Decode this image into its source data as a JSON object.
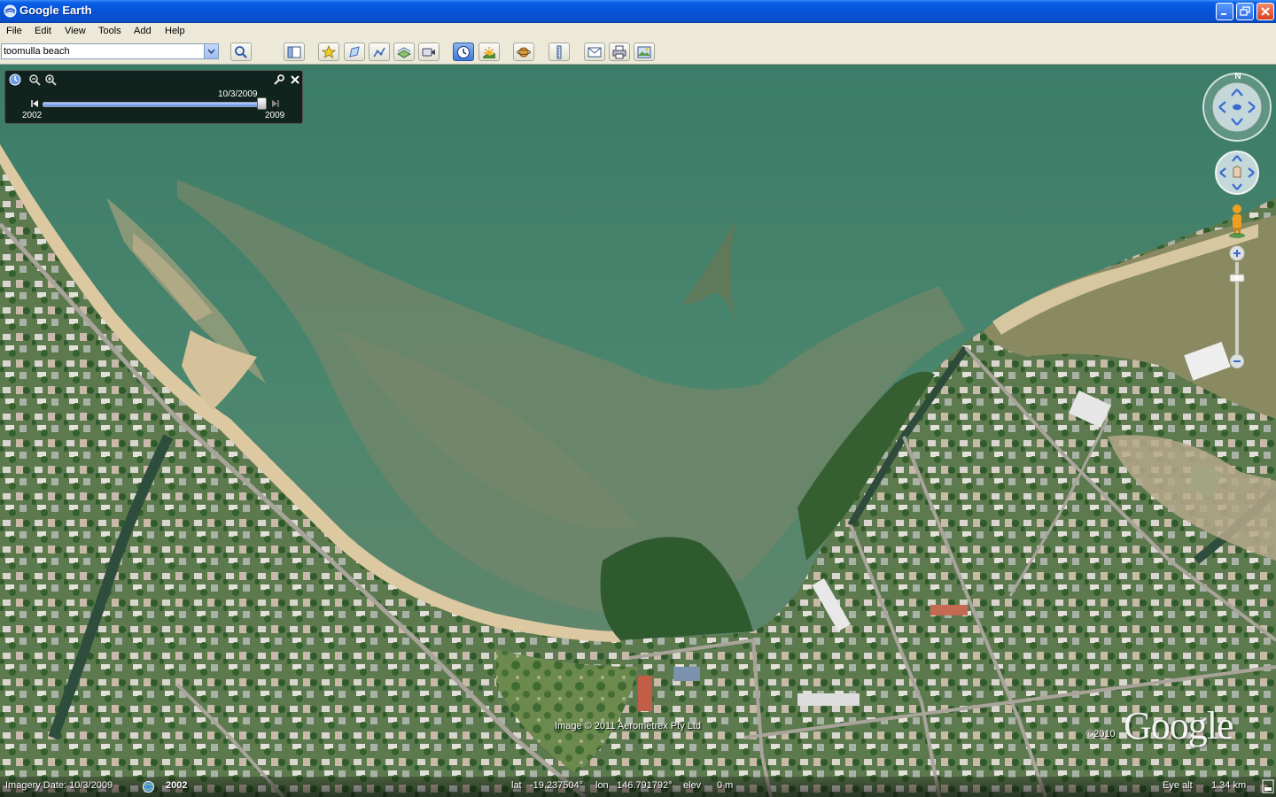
{
  "window": {
    "title": "Google Earth"
  },
  "menu": [
    "File",
    "Edit",
    "View",
    "Tools",
    "Add",
    "Help"
  ],
  "search": {
    "value": "toomulla beach"
  },
  "toolbar": {
    "icons": [
      "search-icon",
      "sidebar-icon",
      "placemark-icon",
      "polygon-icon",
      "path-icon",
      "image-overlay-icon",
      "record-tour-icon",
      "historical-imagery-icon",
      "sunlight-icon",
      "planets-icon",
      "ruler-icon",
      "email-icon",
      "print-icon",
      "save-image-icon"
    ]
  },
  "timeslider": {
    "current_date": "10/3/2009",
    "start_year": "2002",
    "end_year": "2009",
    "position": 1.0
  },
  "navigation": {
    "north_label": "N",
    "zoom_level": 0.82
  },
  "status": {
    "imagery_date_label": "Imagery Date: 10/3/2009",
    "imagery_year": "2002",
    "lat_label": "lat",
    "lat_value": "-19.237504°",
    "lon_label": "lon",
    "lon_value": "146.791792°",
    "elev_label": "elev",
    "elev_value": "0 m",
    "eye_alt_label": "Eye alt",
    "eye_alt_value": "1.34 km"
  },
  "attribution": {
    "image_credit": "Image © 2011 Aerometrex Pty Ltd",
    "copyright": "©2010",
    "logo": "Google"
  },
  "colors": {
    "water": "#3f7f68",
    "shallows": "#6f8a6a",
    "sand": "#d9c6a0",
    "vegetation": "#3e6e35",
    "titlebar": "#0653d8"
  }
}
